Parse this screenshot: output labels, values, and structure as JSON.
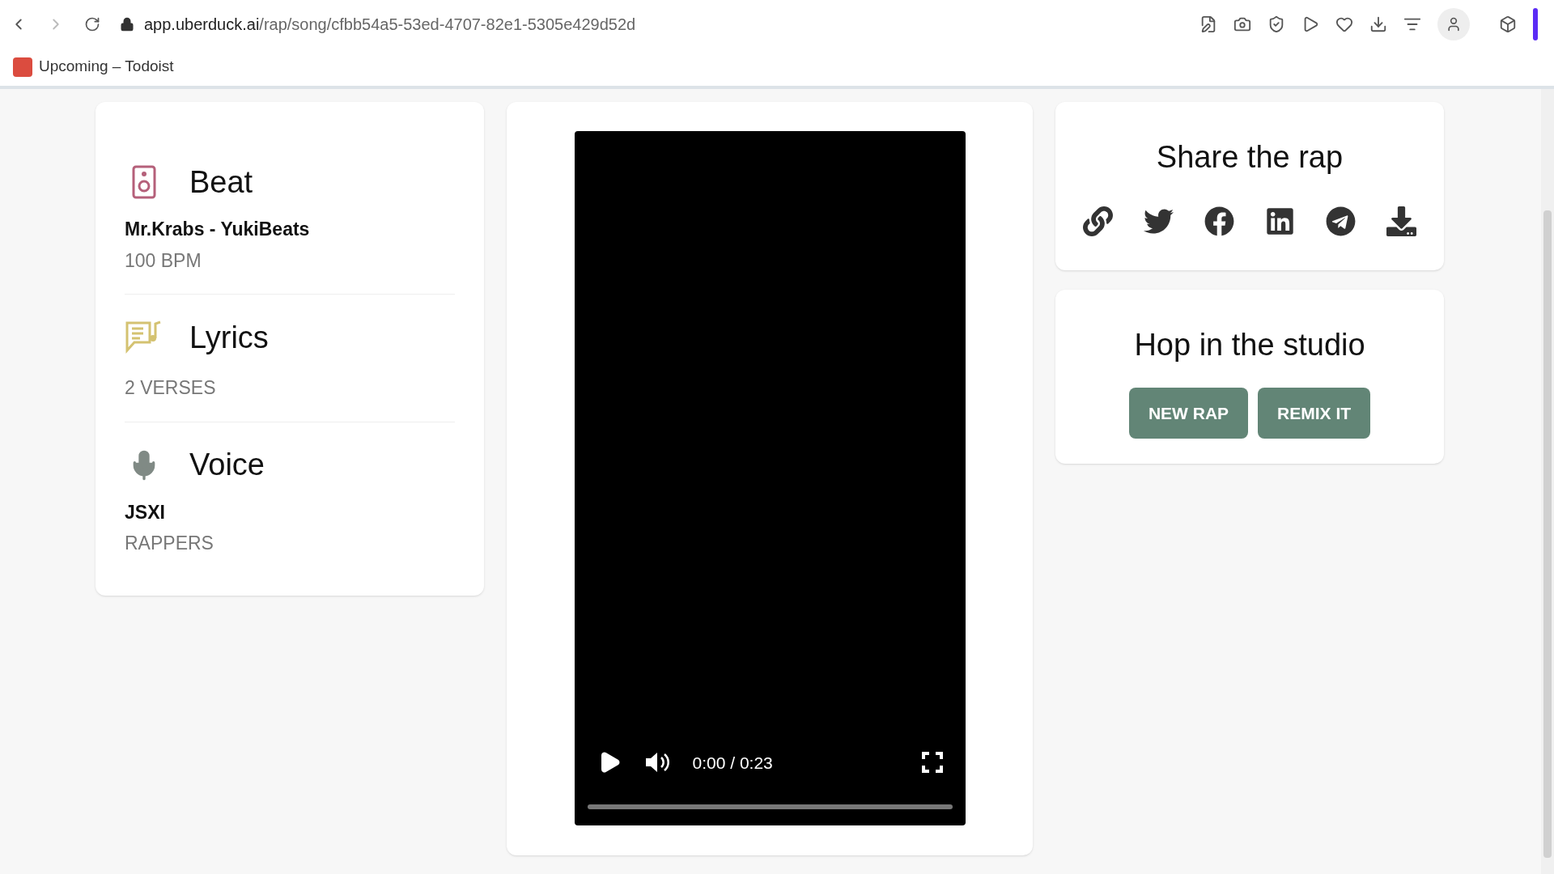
{
  "browser": {
    "url_host": "app.uberduck.ai",
    "url_path": "/rap/song/cfbb54a5-53ed-4707-82e1-5305e429d52d",
    "bookmarks": [
      {
        "label": "Upcoming – Todoist"
      }
    ]
  },
  "details": [
    {
      "kind": "beat",
      "title": "Beat",
      "primary": "Mr.Krabs - YukiBeats",
      "secondary": "100 BPM",
      "color": "#b5607a"
    },
    {
      "kind": "lyrics",
      "title": "Lyrics",
      "secondary": "2 VERSES",
      "color": "#d4c271"
    },
    {
      "kind": "voice",
      "title": "Voice",
      "primary": "JSXI",
      "secondary": "RAPPERS",
      "color": "#808a85"
    }
  ],
  "video": {
    "time": "0:00 / 0:23"
  },
  "share": {
    "title": "Share the rap",
    "actions": [
      {
        "kind": "link"
      },
      {
        "kind": "twitter"
      },
      {
        "kind": "facebook"
      },
      {
        "kind": "linkedin"
      },
      {
        "kind": "telegram"
      },
      {
        "kind": "download"
      }
    ]
  },
  "studio": {
    "title": "Hop in the studio",
    "buttons": [
      "NEW RAP",
      "REMIX IT"
    ]
  }
}
